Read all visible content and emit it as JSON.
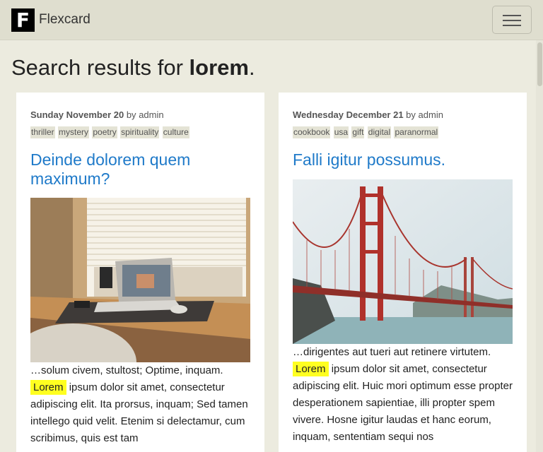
{
  "navbar": {
    "logo_letter": "F",
    "brand": "Flexcard"
  },
  "heading": {
    "prefix": "Search results for ",
    "query": "lorem",
    "suffix": "."
  },
  "cards": [
    {
      "date": "Sunday November 20",
      "by": " by ",
      "author": "admin",
      "tags": [
        "thriller",
        "mystery",
        "poetry",
        "spirituality",
        "culture"
      ],
      "title": "Deinde dolorem quem maximum?",
      "image": "desk-laptop-photo",
      "excerpt_before": "…solum civem, stultost; Optime, inquam. ",
      "match": "Lorem",
      "excerpt_after": " ipsum dolor sit amet, consectetur adipiscing elit. Ita prorsus, inquam; Sed tamen intellego quid velit. Etenim si delectamur, cum scribimus, quis est tam"
    },
    {
      "date": "Wednesday December 21",
      "by": " by ",
      "author": "admin",
      "tags": [
        "cookbook",
        "usa",
        "gift",
        "digital",
        "paranormal"
      ],
      "title": "Falli igitur possumus.",
      "image": "golden-gate-bridge-photo",
      "excerpt_before": "…dirigentes aut tueri aut retinere virtutem. ",
      "match": "Lorem",
      "excerpt_after": " ipsum dolor sit amet, consectetur adipiscing elit. Huic mori optimum esse propter desperationem sapientiae, illi propter spem vivere. Hosne igitur laudas et hanc eorum, inquam, sententiam sequi nos"
    }
  ],
  "colors": {
    "page_bg": "#ecebdf",
    "navbar_bg": "#dfdecf",
    "title_link": "#1f7ac9",
    "highlight": "#ffff20",
    "tag_bg": "#e4e3d5"
  }
}
